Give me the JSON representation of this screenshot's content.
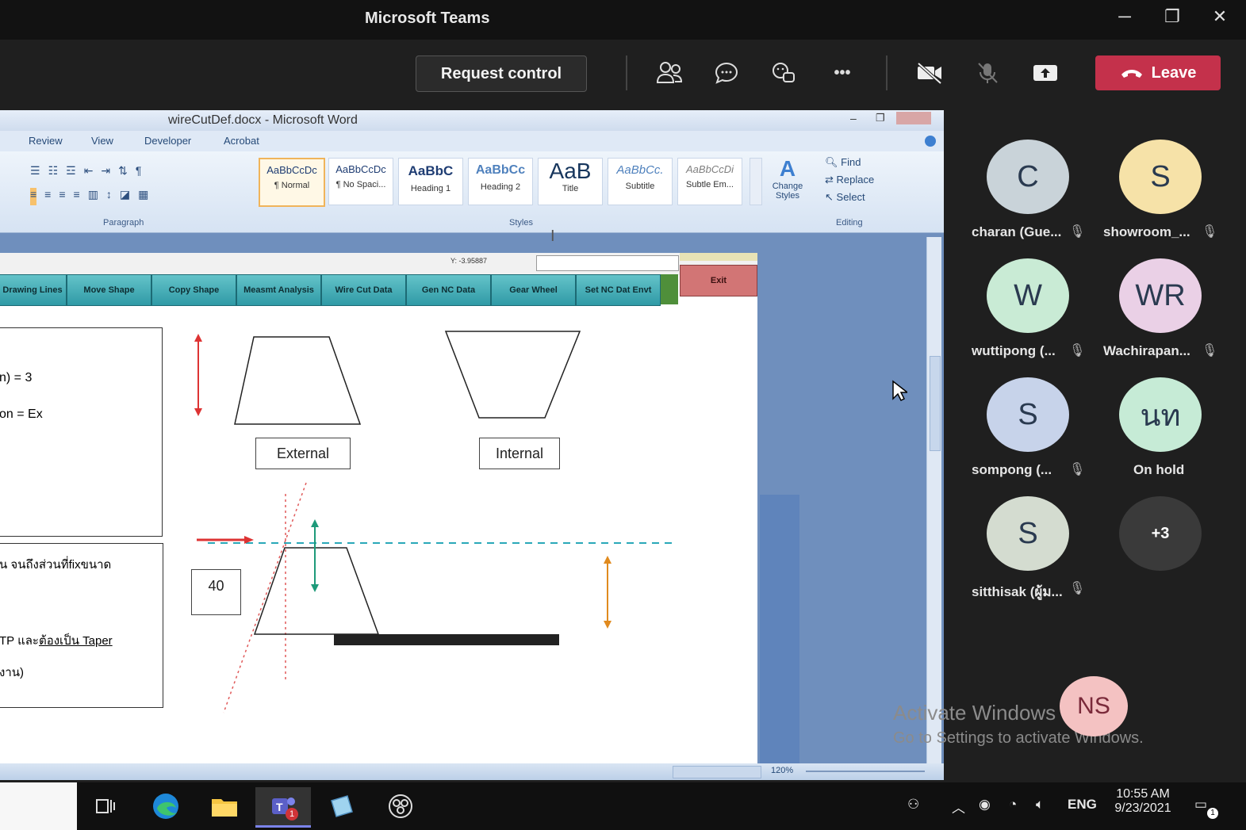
{
  "window": {
    "title": "Microsoft Teams"
  },
  "toolbar": {
    "request_control": "Request control",
    "leave": "Leave",
    "more": "•••"
  },
  "word": {
    "title": "wireCutDef.docx - Microsoft Word",
    "tabs": [
      "Review",
      "View",
      "Developer",
      "Acrobat"
    ],
    "styles": [
      {
        "sample": "AaBbCcDc",
        "label": "¶ Normal"
      },
      {
        "sample": "AaBbCcDc",
        "label": "¶ No Spaci..."
      },
      {
        "sample": "AaBbC",
        "label": "Heading 1"
      },
      {
        "sample": "AaBbCc",
        "label": "Heading 2"
      },
      {
        "sample": "AaB",
        "label": "Title"
      },
      {
        "sample": "AaBbCc.",
        "label": "Subtitle"
      },
      {
        "sample": "AaBbCcDi",
        "label": "Subtle Em..."
      }
    ],
    "change_styles": "Change Styles",
    "editing": {
      "find": "Find",
      "replace": "Replace",
      "select": "Select"
    },
    "groups": {
      "paragraph": "Paragraph",
      "styles": "Styles",
      "editing": "Editing"
    },
    "coord_readout": "Y: -3.95887",
    "app_buttons": [
      "Drawing Lines",
      "Move Shape",
      "Copy Shape",
      "Measmt Analysis",
      "Wire Cut Data",
      "Gen NC Data",
      "Gear Wheel",
      "Set NC Dat Envt"
    ],
    "exit": "Exit",
    "doc_text": {
      "line1": "n) = 3",
      "line2": "on = Ex",
      "line3": "น จนถึงส่วนที่fixขนาด",
      "line4a": "TP และ",
      "line4b": "ต้องเป็น Taper",
      "line5": "งาน)"
    },
    "label_external": "External",
    "label_internal": "Internal",
    "label_40": "40",
    "zoom": "120%"
  },
  "participants": [
    {
      "initials": "C",
      "name": "charan (Gue...",
      "color": "#c9d3d9"
    },
    {
      "initials": "S",
      "name": "showroom_...",
      "color": "#f6e2a8"
    },
    {
      "initials": "W",
      "name": "wuttipong (...",
      "color": "#c9ebd5"
    },
    {
      "initials": "WR",
      "name": "Wachirapan...",
      "color": "#ead0e6"
    },
    {
      "initials": "S",
      "name": "sompong (...",
      "color": "#c7d3ea"
    },
    {
      "initials": "นท",
      "name": "On hold",
      "color": "#c6ebd6"
    },
    {
      "initials": "S",
      "name": "sitthisak (ผู้ม...",
      "color": "#d4dcd0"
    },
    {
      "initials": "+3",
      "name": "",
      "color": "#3a3a3a"
    }
  ],
  "self_avatar": {
    "initials": "NS",
    "color": "#f4c2c2"
  },
  "watermark": {
    "line1": "Activate Windows",
    "line2": "Go to Settings to activate Windows."
  },
  "taskbar": {
    "lang": "ENG",
    "time": "10:55 AM",
    "date": "9/23/2021",
    "teams_badge": "1",
    "notif_badge": "1"
  }
}
